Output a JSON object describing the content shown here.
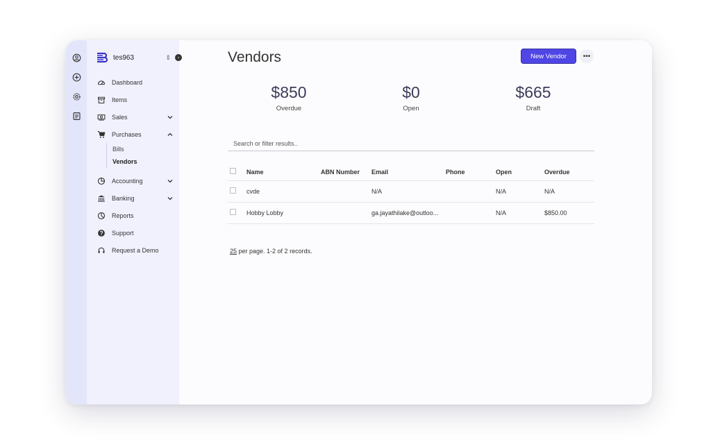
{
  "org": {
    "name": "tes963",
    "switch_icon": "updown-icon",
    "collapse_icon": "collapse-icon"
  },
  "rail": [
    "account-icon",
    "add-icon",
    "gear-icon",
    "notes-icon"
  ],
  "nav": {
    "dashboard": "Dashboard",
    "items": "Items",
    "sales": "Sales",
    "purchases": "Purchases",
    "purchases_sub": [
      "Bills",
      "Vendors"
    ],
    "accounting": "Accounting",
    "banking": "Banking",
    "reports": "Reports",
    "support": "Support",
    "demo": "Request a Demo"
  },
  "page": {
    "title": "Vendors",
    "new_button": "New Vendor",
    "more_label": "•••"
  },
  "stats": [
    {
      "value": "$850",
      "label": "Overdue"
    },
    {
      "value": "$0",
      "label": "Open"
    },
    {
      "value": "$665",
      "label": "Draft"
    }
  ],
  "search": {
    "placeholder": "Search or filter results.."
  },
  "table": {
    "headers": [
      "Name",
      "ABN Number",
      "Email",
      "Phone",
      "Open",
      "Overdue"
    ],
    "rows": [
      {
        "name": "cvde",
        "abn": "",
        "email": "N/A",
        "phone": "",
        "open": "N/A",
        "overdue": "N/A"
      },
      {
        "name": "Hobby Lobby",
        "abn": "",
        "email": "ga.jayathilake@outloo...",
        "phone": "",
        "open": "N/A",
        "overdue": "$850.00"
      }
    ]
  },
  "pager": {
    "per_page": "25",
    "text": " per page. 1-2 of 2 records."
  },
  "colors": {
    "accent": "#4f46e5",
    "sidebar": "#f0f1fd",
    "rail": "#e3e6fb"
  }
}
